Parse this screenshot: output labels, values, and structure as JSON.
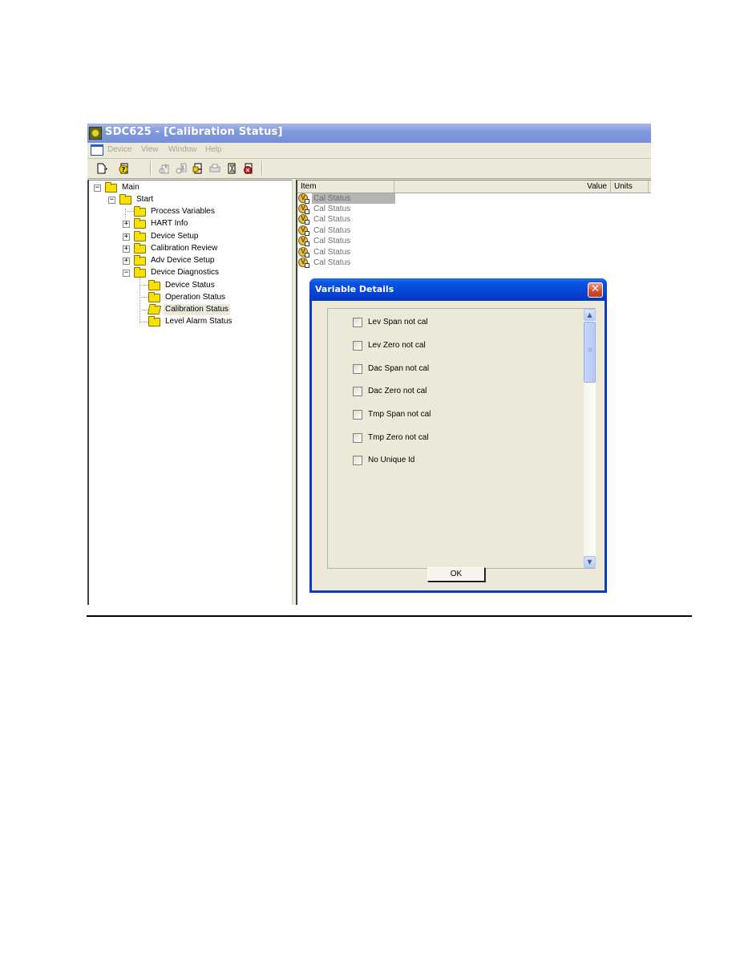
{
  "window": {
    "title": "SDC625 - [Calibration Status]"
  },
  "menubar": {
    "items": [
      "Device",
      "View",
      "Window",
      "Help"
    ]
  },
  "toolbar": {
    "buttons": [
      "new-document-icon",
      "help-icon",
      "upload-icon",
      "download-icon",
      "export-icon",
      "print-icon",
      "timer-icon",
      "stop-icon"
    ]
  },
  "tree": {
    "nodes": [
      {
        "label": "Main",
        "expander": "−"
      },
      {
        "label": "Start",
        "expander": "−"
      },
      {
        "label": "Process Variables",
        "expander": ""
      },
      {
        "label": "HART Info",
        "expander": "+"
      },
      {
        "label": "Device Setup",
        "expander": "+"
      },
      {
        "label": "Calibration Review",
        "expander": "+"
      },
      {
        "label": "Adv Device Setup",
        "expander": "+"
      },
      {
        "label": "Device Diagnostics",
        "expander": "−"
      },
      {
        "label": "Device Status",
        "expander": ""
      },
      {
        "label": "Operation Status",
        "expander": ""
      },
      {
        "label": "Calibration Status",
        "expander": "",
        "selected": true
      },
      {
        "label": "Level Alarm Status",
        "expander": ""
      }
    ]
  },
  "list": {
    "columns": [
      "Item",
      "Value",
      "Units"
    ],
    "rows": [
      "Cal Status",
      "Cal Status",
      "Cal Status",
      "Cal Status",
      "Cal Status",
      "Cal Status",
      "Cal Status"
    ],
    "icon_letter": "V"
  },
  "dialog": {
    "title": "Variable Details",
    "close_symbol": "✕",
    "checkboxes": [
      {
        "label": "Lev Span not cal",
        "checked": false
      },
      {
        "label": "Lev Zero not cal",
        "checked": false
      },
      {
        "label": "Dac Span not cal",
        "checked": false
      },
      {
        "label": "Dac Zero not cal",
        "checked": false
      },
      {
        "label": "Tmp Span not cal",
        "checked": false
      },
      {
        "label": "Tmp Zero not cal",
        "checked": false
      },
      {
        "label": "No Unique Id",
        "checked": false
      }
    ],
    "scroll_up_symbol": "▲",
    "scroll_down_symbol": "▼",
    "ok_label": "OK"
  }
}
